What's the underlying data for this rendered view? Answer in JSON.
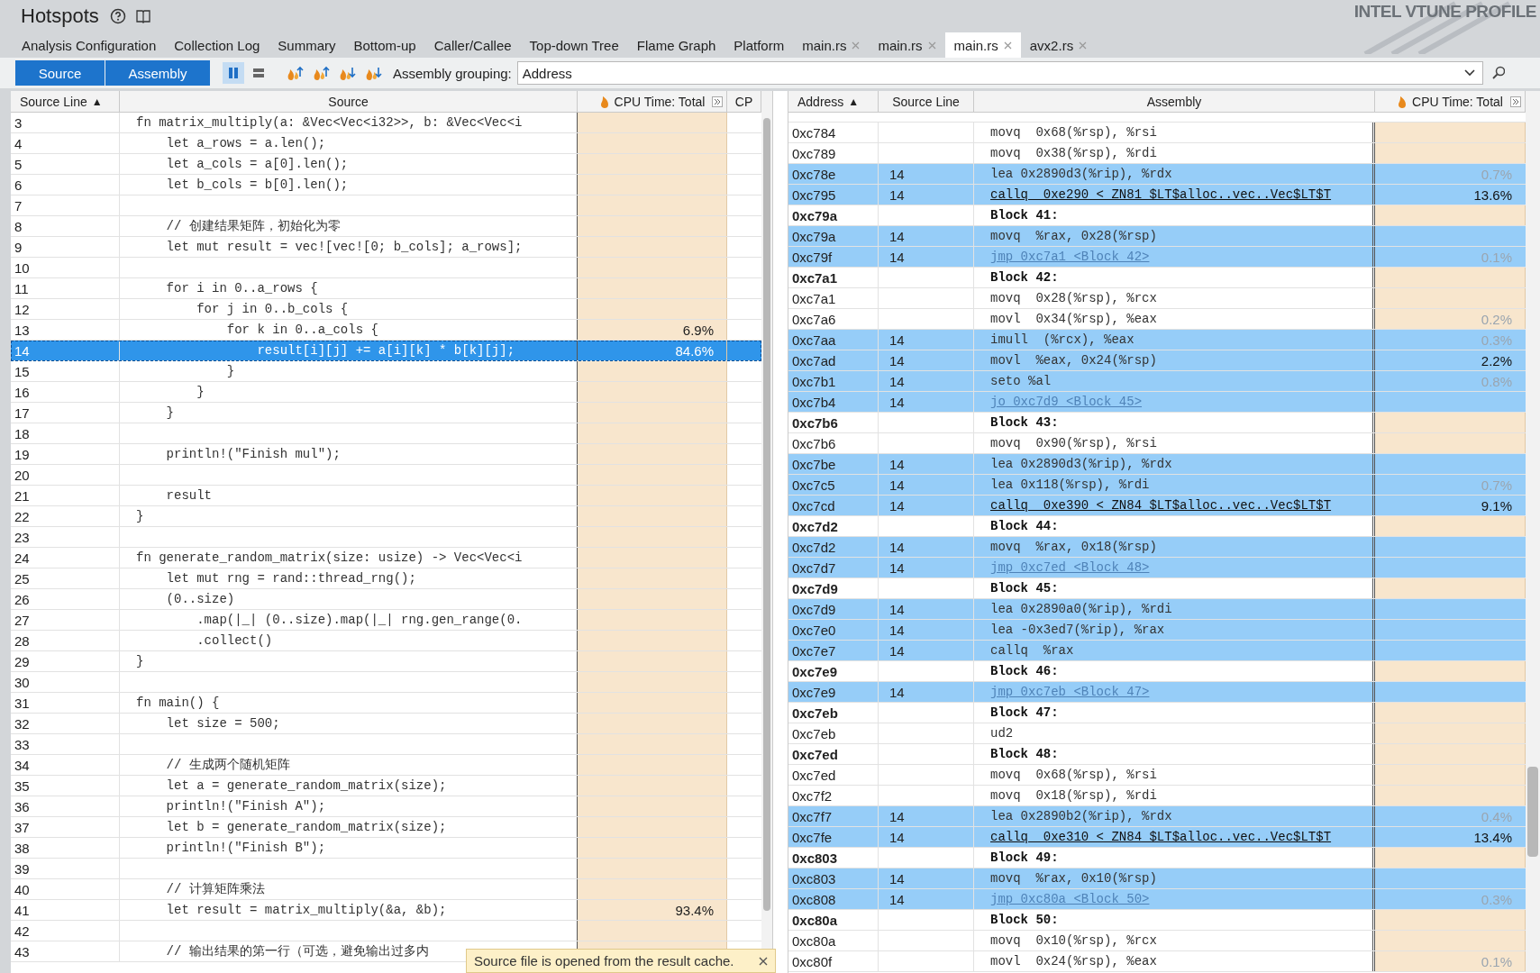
{
  "window": {
    "title": "Hotspots",
    "logo": "INTEL VTUNE PROFILE"
  },
  "tabs": [
    {
      "label": "Analysis Configuration",
      "closable": false,
      "selected": false
    },
    {
      "label": "Collection Log",
      "closable": false,
      "selected": false
    },
    {
      "label": "Summary",
      "closable": false,
      "selected": false
    },
    {
      "label": "Bottom-up",
      "closable": false,
      "selected": false
    },
    {
      "label": "Caller/Callee",
      "closable": false,
      "selected": false
    },
    {
      "label": "Top-down Tree",
      "closable": false,
      "selected": false
    },
    {
      "label": "Flame Graph",
      "closable": false,
      "selected": false
    },
    {
      "label": "Platform",
      "closable": false,
      "selected": false
    },
    {
      "label": "main.rs",
      "closable": true,
      "selected": false
    },
    {
      "label": "main.rs",
      "closable": true,
      "selected": false
    },
    {
      "label": "main.rs",
      "closable": true,
      "selected": true
    },
    {
      "label": "avx2.rs",
      "closable": true,
      "selected": false
    }
  ],
  "toolbar": {
    "views": [
      {
        "label": "Source",
        "selected": true
      },
      {
        "label": "Assembly",
        "selected": true
      }
    ],
    "layouts": [
      {
        "kind": "columns",
        "selected": true
      },
      {
        "kind": "rows",
        "selected": false
      }
    ],
    "grouping_label": "Assembly grouping:",
    "grouping_value": "Address"
  },
  "source_pane": {
    "columns": [
      {
        "label": "Source Line",
        "sort_mark": "▲"
      },
      {
        "label": "Source"
      },
      {
        "label": "CPU Time: Total",
        "kind": "metric"
      },
      {
        "label": "CP"
      }
    ],
    "rows": [
      {
        "line": "3",
        "code": "fn matrix_multiply(a: &Vec<Vec<i32>>, b: &Vec<Vec<i",
        "selected": false
      },
      {
        "line": "4",
        "code": "    let a_rows = a.len();",
        "selected": false
      },
      {
        "line": "5",
        "code": "    let a_cols = a[0].len();",
        "selected": false
      },
      {
        "line": "6",
        "code": "    let b_cols = b[0].len();",
        "selected": false
      },
      {
        "line": "7",
        "selected": false
      },
      {
        "line": "8",
        "code": "    // 创建结果矩阵，初始化为零",
        "selected": false
      },
      {
        "line": "9",
        "code": "    let mut result = vec![vec![0; b_cols]; a_rows];",
        "selected": false
      },
      {
        "line": "10",
        "selected": false
      },
      {
        "line": "11",
        "code": "    for i in 0..a_rows {",
        "selected": false
      },
      {
        "line": "12",
        "code": "        for j in 0..b_cols {",
        "selected": false
      },
      {
        "line": "13",
        "code": "            for k in 0..a_cols {",
        "cpu": "6.9%",
        "selected": false
      },
      {
        "line": "14",
        "code": "                result[i][j] += a[i][k] * b[k][j];",
        "cpu": "84.6%",
        "selected": true
      },
      {
        "line": "15",
        "code": "            }",
        "selected": false
      },
      {
        "line": "16",
        "code": "        }",
        "selected": false
      },
      {
        "line": "17",
        "code": "    }",
        "selected": false
      },
      {
        "line": "18",
        "selected": false
      },
      {
        "line": "19",
        "code": "    println!(\"Finish mul\");",
        "selected": false
      },
      {
        "line": "20",
        "selected": false
      },
      {
        "line": "21",
        "code": "    result",
        "selected": false
      },
      {
        "line": "22",
        "code": "}",
        "selected": false
      },
      {
        "line": "23",
        "selected": false
      },
      {
        "line": "24",
        "code": "fn generate_random_matrix(size: usize) -> Vec<Vec<i",
        "selected": false
      },
      {
        "line": "25",
        "code": "    let mut rng = rand::thread_rng();",
        "selected": false
      },
      {
        "line": "26",
        "code": "    (0..size)",
        "selected": false
      },
      {
        "line": "27",
        "code": "        .map(|_| (0..size).map(|_| rng.gen_range(0.",
        "selected": false
      },
      {
        "line": "28",
        "code": "        .collect()",
        "selected": false
      },
      {
        "line": "29",
        "code": "}",
        "selected": false
      },
      {
        "line": "30",
        "selected": false
      },
      {
        "line": "31",
        "code": "fn main() {",
        "selected": false
      },
      {
        "line": "32",
        "code": "    let size = 500;",
        "selected": false
      },
      {
        "line": "33",
        "selected": false
      },
      {
        "line": "34",
        "code": "    // 生成两个随机矩阵",
        "selected": false
      },
      {
        "line": "35",
        "code": "    let a = generate_random_matrix(size);",
        "selected": false
      },
      {
        "line": "36",
        "code": "    println!(\"Finish A\");",
        "selected": false
      },
      {
        "line": "37",
        "code": "    let b = generate_random_matrix(size);",
        "selected": false
      },
      {
        "line": "38",
        "code": "    println!(\"Finish B\");",
        "selected": false
      },
      {
        "line": "39",
        "selected": false
      },
      {
        "line": "40",
        "code": "    // 计算矩阵乘法",
        "selected": false
      },
      {
        "line": "41",
        "code": "    let result = matrix_multiply(&a, &b);",
        "cpu": "93.4%",
        "selected": false
      },
      {
        "line": "42",
        "selected": false
      },
      {
        "line": "43",
        "code": "    // 输出结果的第一行（可选，避免输出过多内",
        "selected": false
      }
    ]
  },
  "assembly_pane": {
    "columns": [
      {
        "label": "Address",
        "sort_mark": "▲"
      },
      {
        "label": "Source Line"
      },
      {
        "label": "Assembly"
      },
      {
        "label": "CPU Time: Total",
        "kind": "metric"
      }
    ],
    "rows": [
      {
        "address": "0xc784",
        "kind": "instr",
        "asm": "movq  0x68(%rsp), %rsi",
        "highlighted": false
      },
      {
        "address": "0xc789",
        "kind": "instr",
        "asm": "movq  0x38(%rsp), %rdi",
        "highlighted": false
      },
      {
        "address": "0xc78e",
        "line": "14",
        "kind": "instr",
        "asm": "lea 0x2890d3(%rip), %rdx",
        "cpu": "0.7%",
        "highlighted": true
      },
      {
        "address": "0xc795",
        "line": "14",
        "kind": "call",
        "asm": "callq  0xe290 <_ZN81_$LT$alloc..vec..Vec$LT$T",
        "cpu": "13.6%",
        "highlighted": true
      },
      {
        "address": "0xc79a",
        "kind": "block",
        "asm": "Block 41:",
        "highlighted": false
      },
      {
        "address": "0xc79a",
        "line": "14",
        "kind": "instr",
        "asm": "movq  %rax, 0x28(%rsp)",
        "highlighted": true
      },
      {
        "address": "0xc79f",
        "line": "14",
        "kind": "jump",
        "asm": "jmp 0xc7a1 <Block 42>",
        "cpu": "0.1%",
        "highlighted": true
      },
      {
        "address": "0xc7a1",
        "kind": "block",
        "asm": "Block 42:",
        "highlighted": false
      },
      {
        "address": "0xc7a1",
        "kind": "instr",
        "asm": "movq  0x28(%rsp), %rcx",
        "highlighted": false
      },
      {
        "address": "0xc7a6",
        "kind": "instr",
        "asm": "movl  0x34(%rsp), %eax",
        "cpu": "0.2%",
        "highlighted": false
      },
      {
        "address": "0xc7aa",
        "line": "14",
        "kind": "instr",
        "asm": "imull  (%rcx), %eax",
        "cpu": "0.3%",
        "highlighted": true
      },
      {
        "address": "0xc7ad",
        "line": "14",
        "kind": "instr",
        "asm": "movl  %eax, 0x24(%rsp)",
        "cpu": "2.2%",
        "highlighted": true
      },
      {
        "address": "0xc7b1",
        "line": "14",
        "kind": "instr",
        "asm": "seto %al",
        "cpu": "0.8%",
        "highlighted": true
      },
      {
        "address": "0xc7b4",
        "line": "14",
        "kind": "jump",
        "asm": "jo 0xc7d9 <Block 45>",
        "highlighted": true
      },
      {
        "address": "0xc7b6",
        "kind": "block",
        "asm": "Block 43:",
        "highlighted": false
      },
      {
        "address": "0xc7b6",
        "kind": "instr",
        "asm": "movq  0x90(%rsp), %rsi",
        "highlighted": false
      },
      {
        "address": "0xc7be",
        "line": "14",
        "kind": "instr",
        "asm": "lea 0x2890d3(%rip), %rdx",
        "highlighted": true
      },
      {
        "address": "0xc7c5",
        "line": "14",
        "kind": "instr",
        "asm": "lea 0x118(%rsp), %rdi",
        "cpu": "0.7%",
        "highlighted": true
      },
      {
        "address": "0xc7cd",
        "line": "14",
        "kind": "call",
        "asm": "callq  0xe390 <_ZN84_$LT$alloc..vec..Vec$LT$T",
        "cpu": "9.1%",
        "highlighted": true
      },
      {
        "address": "0xc7d2",
        "kind": "block",
        "asm": "Block 44:",
        "highlighted": false
      },
      {
        "address": "0xc7d2",
        "line": "14",
        "kind": "instr",
        "asm": "movq  %rax, 0x18(%rsp)",
        "highlighted": true
      },
      {
        "address": "0xc7d7",
        "line": "14",
        "kind": "jump",
        "asm": "jmp 0xc7ed <Block 48>",
        "highlighted": true
      },
      {
        "address": "0xc7d9",
        "kind": "block",
        "asm": "Block 45:",
        "highlighted": false
      },
      {
        "address": "0xc7d9",
        "line": "14",
        "kind": "instr",
        "asm": "lea 0x2890a0(%rip), %rdi",
        "highlighted": true
      },
      {
        "address": "0xc7e0",
        "line": "14",
        "kind": "instr",
        "asm": "lea -0x3ed7(%rip), %rax",
        "highlighted": true
      },
      {
        "address": "0xc7e7",
        "line": "14",
        "kind": "instr",
        "asm": "callq  %rax",
        "highlighted": true
      },
      {
        "address": "0xc7e9",
        "kind": "block",
        "asm": "Block 46:",
        "highlighted": false
      },
      {
        "address": "0xc7e9",
        "line": "14",
        "kind": "jump",
        "asm": "jmp 0xc7eb <Block 47>",
        "highlighted": true
      },
      {
        "address": "0xc7eb",
        "kind": "block",
        "asm": "Block 47:",
        "highlighted": false
      },
      {
        "address": "0xc7eb",
        "kind": "instr",
        "asm": "ud2",
        "highlighted": false
      },
      {
        "address": "0xc7ed",
        "kind": "block",
        "asm": "Block 48:",
        "highlighted": false
      },
      {
        "address": "0xc7ed",
        "kind": "instr",
        "asm": "movq  0x68(%rsp), %rsi",
        "highlighted": false
      },
      {
        "address": "0xc7f2",
        "kind": "instr",
        "asm": "movq  0x18(%rsp), %rdi",
        "highlighted": false
      },
      {
        "address": "0xc7f7",
        "line": "14",
        "kind": "instr",
        "asm": "lea 0x2890b2(%rip), %rdx",
        "cpu": "0.4%",
        "highlighted": true
      },
      {
        "address": "0xc7fe",
        "line": "14",
        "kind": "call",
        "asm": "callq  0xe310 <_ZN84_$LT$alloc..vec..Vec$LT$T",
        "cpu": "13.4%",
        "highlighted": true
      },
      {
        "address": "0xc803",
        "kind": "block",
        "asm": "Block 49:",
        "highlighted": false
      },
      {
        "address": "0xc803",
        "line": "14",
        "kind": "instr",
        "asm": "movq  %rax, 0x10(%rsp)",
        "highlighted": true
      },
      {
        "address": "0xc808",
        "line": "14",
        "kind": "jump",
        "asm": "jmp 0xc80a <Block 50>",
        "cpu": "0.3%",
        "highlighted": true
      },
      {
        "address": "0xc80a",
        "kind": "block",
        "asm": "Block 50:",
        "highlighted": false
      },
      {
        "address": "0xc80a",
        "kind": "instr",
        "asm": "movq  0x10(%rsp), %rcx",
        "highlighted": false
      },
      {
        "address": "0xc80f",
        "kind": "instr",
        "asm": "movl  0x24(%rsp), %eax",
        "cpu": "0.1%",
        "highlighted": false
      }
    ]
  },
  "toast": {
    "text": "Source file is opened from the result cache."
  }
}
